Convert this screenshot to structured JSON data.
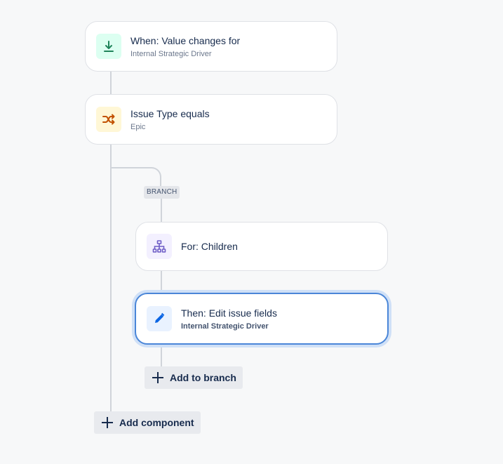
{
  "trigger": {
    "title": "When: Value changes for",
    "subtitle": "Internal Strategic Driver",
    "icon": "field-value-changed-icon",
    "icon_bg": "#dcfff1",
    "icon_color": "#1f845a"
  },
  "condition": {
    "title": "Issue Type equals",
    "subtitle": "Epic",
    "icon": "shuffle-condition-icon",
    "icon_bg": "#fff7d6",
    "icon_color": "#c25100"
  },
  "branch": {
    "tag": "BRANCH",
    "branch_rule": {
      "title": "For: Children",
      "icon": "hierarchy-icon",
      "icon_bg": "#f3f0ff",
      "icon_color": "#6e5dc6"
    },
    "action": {
      "title": "Then: Edit issue fields",
      "subtitle": "Internal Strategic Driver",
      "icon": "pencil-icon",
      "icon_bg": "#e9f2ff",
      "icon_color": "#0c66e4"
    },
    "add_label": "Add to branch"
  },
  "add_component_label": "Add component",
  "colors": {
    "selected_border": "#4a86d8",
    "connector": "#d0d4da",
    "background": "#f7f8f9"
  }
}
